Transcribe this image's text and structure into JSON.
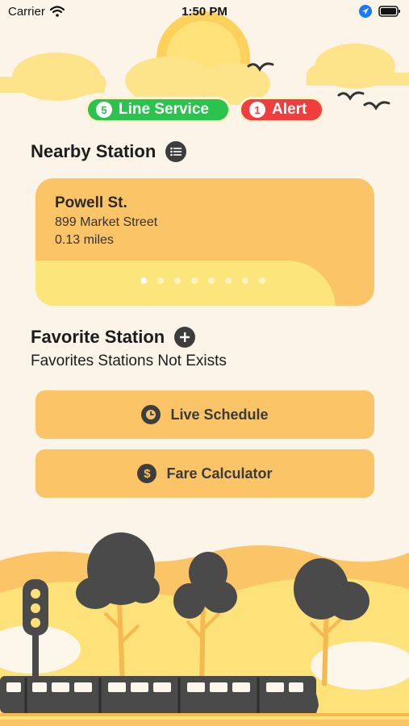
{
  "status_bar": {
    "carrier": "Carrier",
    "time": "1:50 PM"
  },
  "badges": {
    "line_service": {
      "count": "5",
      "label": "Line Service",
      "color": "#2cc24e"
    },
    "alert": {
      "count": "1",
      "label": "Alert",
      "color": "#f13d3d"
    }
  },
  "nearby": {
    "title": "Nearby Station",
    "list_icon": "list-icon",
    "station": {
      "name": "Powell St.",
      "address": "899 Market Street",
      "distance": "0.13 miles"
    },
    "pager": {
      "total": 8,
      "active": 1
    }
  },
  "favorites": {
    "title": "Favorite Station",
    "add_icon": "plus-icon",
    "empty_text": "Favorites Stations Not Exists"
  },
  "actions": {
    "live_schedule": {
      "label": "Live Schedule",
      "icon": "clock-icon"
    },
    "fare_calculator": {
      "label": "Fare Calculator",
      "icon": "dollar-icon"
    }
  },
  "colors": {
    "background": "#fcf4e8",
    "card": "#fbc466",
    "card_wave": "#fce57a",
    "dark": "#3d3d3d"
  }
}
